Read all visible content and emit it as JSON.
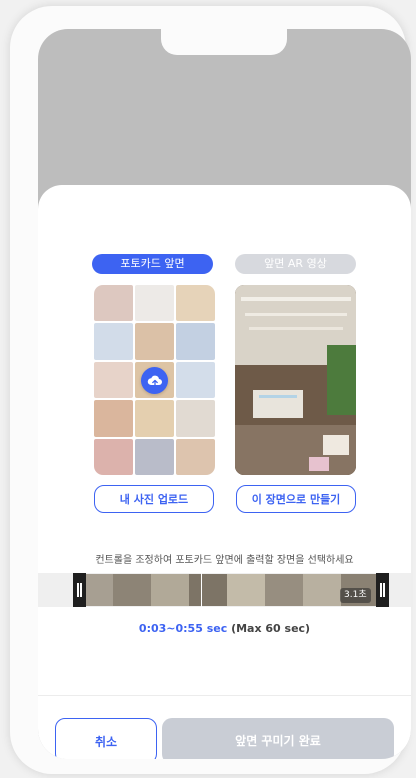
{
  "tabs": {
    "active": "포토카드 앞면",
    "inactive": "앞면 AR 영상"
  },
  "buttons": {
    "upload": "내 사진 업로드",
    "make_from_scene": "이 장면으로 만들기",
    "cancel": "취소",
    "done": "앞면 꾸미기 완료"
  },
  "instruction": "컨트롤을 조정하여 포토카드 앞면에 출력할 장면을 선택하세요",
  "timeline": {
    "duration_badge": "3.1초"
  },
  "range": {
    "value": "0:03~0:55 sec",
    "max": "(Max 60 sec)"
  },
  "icons": {
    "upload": "cloud-upload-icon",
    "handle": "trim-handle-icon"
  },
  "colors": {
    "accent": "#3d63f2",
    "disabled": "#c9cdd5",
    "inactive_tab": "#d7d9de"
  }
}
